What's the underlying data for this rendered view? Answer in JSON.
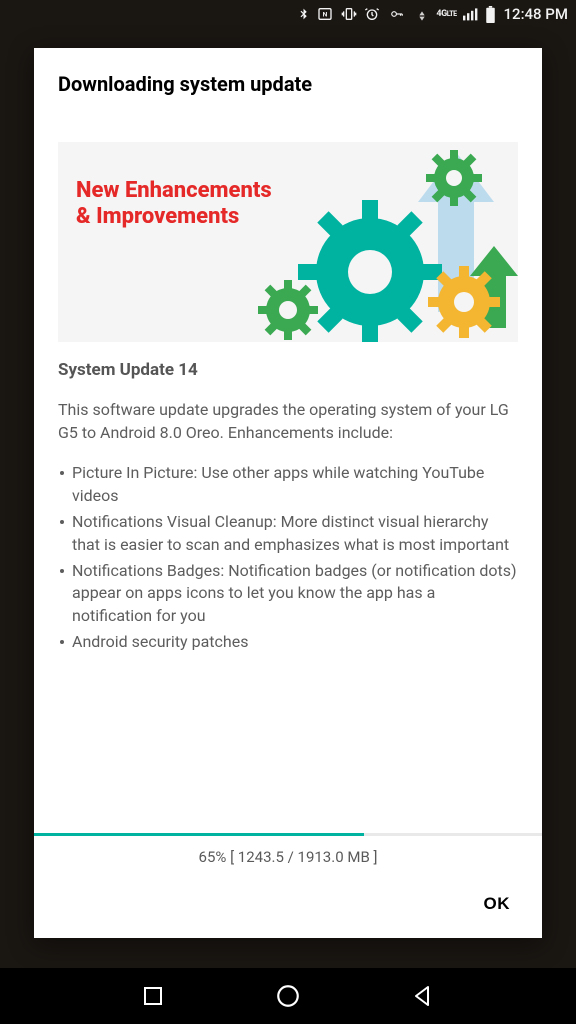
{
  "status_bar": {
    "time": "12:48 PM",
    "network_label": "4G",
    "icons": [
      "bluetooth",
      "nfc",
      "vibrate",
      "alarm",
      "vpn-key",
      "wifi-activity",
      "4g-lte",
      "signal",
      "battery"
    ]
  },
  "dialog": {
    "title": "Downloading system update",
    "banner": {
      "line1": "New Enhancements",
      "line2": "& Improvements"
    },
    "subtitle": "System Update 14",
    "description": "This software update upgrades the operating system of your LG G5 to Android 8.0 Oreo. Enhancements include:",
    "bullets": [
      "Picture In Picture: Use other apps while watching YouTube videos",
      "Notifications Visual Cleanup: More distinct visual hierarchy that is easier to scan and emphasizes what is most important",
      "Notifications Badges: Notification badges (or notification dots) appear on apps icons to let you know the app has a notification for you",
      "Android security patches"
    ],
    "progress": {
      "percent": 65,
      "downloaded_mb": 1243.5,
      "total_mb": 1913.0,
      "text": "65% [ 1243.5 / 1913.0 MB ]"
    },
    "ok_label": "OK"
  },
  "colors": {
    "accent_teal": "#00b3a1",
    "brand_red": "#e52929"
  }
}
